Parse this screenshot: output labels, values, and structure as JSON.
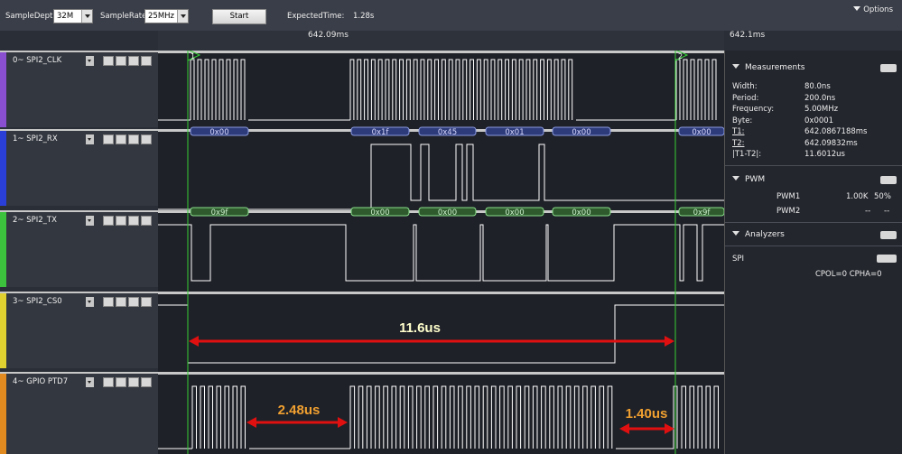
{
  "toolbar": {
    "sample_depth_label": "SampleDepth",
    "sample_depth_value": "32M",
    "sample_rate_label": "SampleRate",
    "sample_rate_value": "25MHz",
    "start_label": "Start",
    "expected_time_label": "ExpectedTime:",
    "expected_time_value": "1.28s",
    "options_label": "Options"
  },
  "ruler": {
    "label_left": "642.09ms",
    "label_right": "642.1ms"
  },
  "cursors": {
    "t1_label": "1",
    "t2_label": "2"
  },
  "channels": [
    {
      "name": "0~ SPI2_CLK",
      "color": "#8a4fd0"
    },
    {
      "name": "1~ SPI2_RX",
      "color": "#2a3fd8"
    },
    {
      "name": "2~ SPI2_TX",
      "color": "#3cc23c"
    },
    {
      "name": "3~ SPI2_CS0",
      "color": "#e0d030"
    },
    {
      "name": "4~ GPIO PTD7",
      "color": "#e08a20"
    }
  ],
  "rx_bytes": [
    "0x00",
    "0x1f",
    "0x45",
    "0x01",
    "0x00",
    "0x00"
  ],
  "tx_bytes": [
    "0x9f",
    "0x00",
    "0x00",
    "0x00",
    "0x00",
    "0x9f"
  ],
  "annotations": {
    "cs_span": "11.6us",
    "gpio_gap": "2.48us",
    "gpio_end": "1.40us"
  },
  "measurements": {
    "title": "Measurements",
    "rows": [
      {
        "label": "Width:",
        "value": "80.0ns"
      },
      {
        "label": "Period:",
        "value": "200.0ns"
      },
      {
        "label": "Frequency:",
        "value": "5.00MHz"
      },
      {
        "label": "Byte:",
        "value": "0x0001"
      },
      {
        "label": "T1:",
        "value": "642.0867188ms"
      },
      {
        "label": "T2:",
        "value": "642.09832ms"
      },
      {
        "label": "|T1-T2|:",
        "value": "11.6012us"
      }
    ]
  },
  "pwm": {
    "title": "PWM",
    "rows": [
      {
        "name": "PWM1",
        "freq": "1.00K",
        "duty": "50%"
      },
      {
        "name": "PWM2",
        "freq": "--",
        "duty": "--"
      }
    ]
  },
  "analyzers": {
    "title": "Analyzers",
    "name": "SPI",
    "config": "CPOL=0 CPHA=0"
  },
  "colors": {
    "wave": "#ffffff",
    "cursor": "#35d035",
    "arrow": "#e01010",
    "label_white": "#ffffcc",
    "label_orange": "#f0a030"
  }
}
